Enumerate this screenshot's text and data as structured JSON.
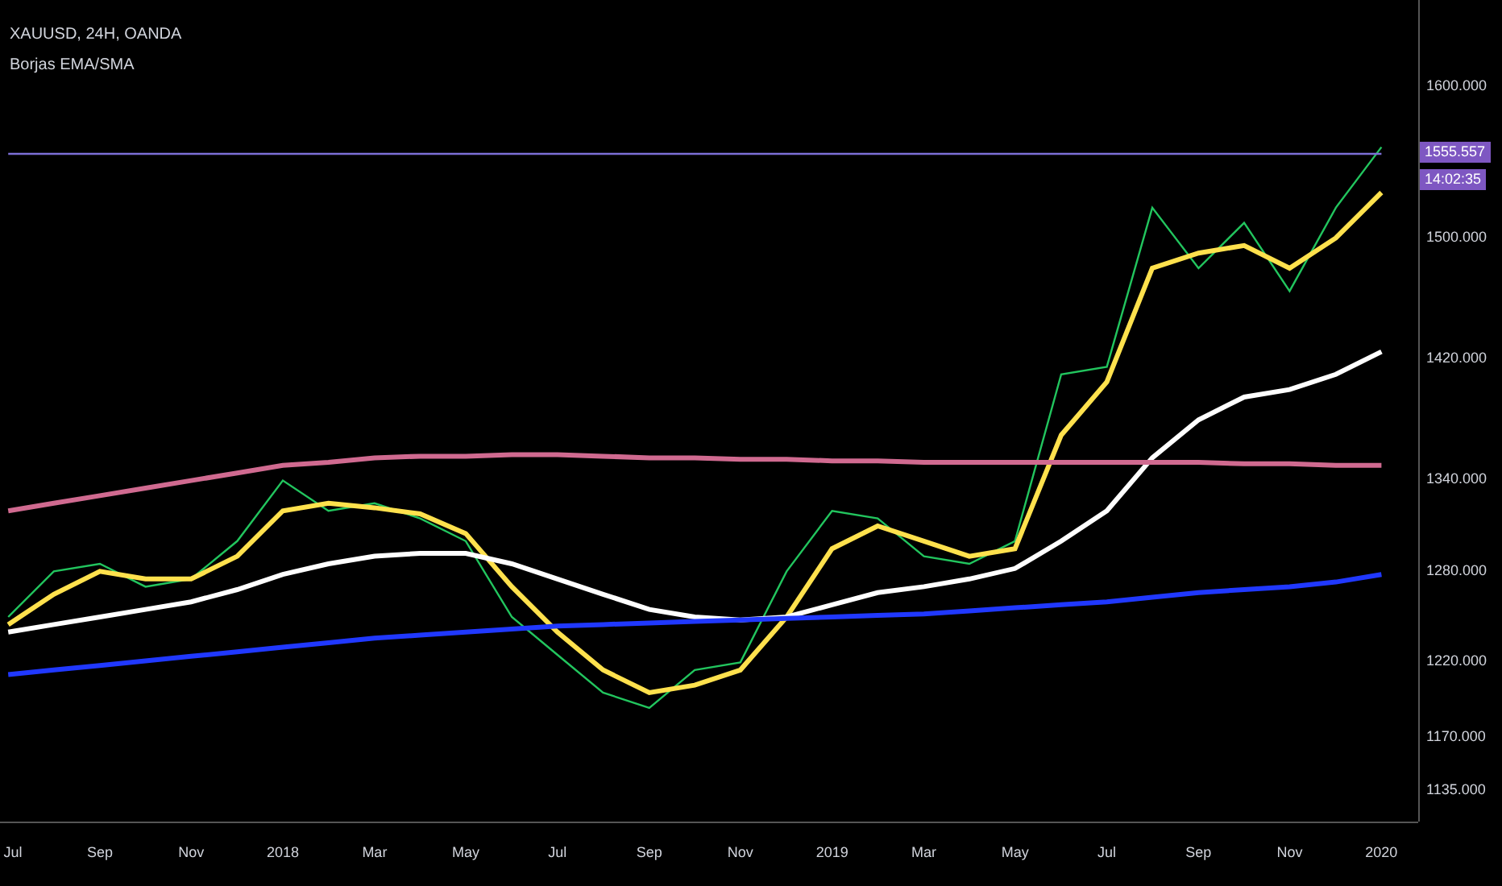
{
  "legend": {
    "symbol": "XAUUSD, 24H, OANDA",
    "indicator": "Borjas EMA/SMA"
  },
  "price_line": {
    "price": "1555.557",
    "countdown": "14:02:35"
  },
  "chart_data": {
    "type": "line",
    "x": [
      2017.5,
      2017.583,
      2017.667,
      2017.75,
      2017.833,
      2017.917,
      2018,
      2018.083,
      2018.167,
      2018.25,
      2018.333,
      2018.417,
      2018.5,
      2018.583,
      2018.667,
      2018.75,
      2018.833,
      2018.917,
      2019,
      2019.083,
      2019.167,
      2019.25,
      2019.333,
      2019.417,
      2019.5,
      2019.583,
      2019.667,
      2019.75,
      2019.833,
      2019.917,
      2020
    ],
    "xticks": [
      {
        "value": 2017.5,
        "label": "Jul"
      },
      {
        "value": 2017.667,
        "label": "Sep"
      },
      {
        "value": 2017.833,
        "label": "Nov"
      },
      {
        "value": 2018,
        "label": "2018"
      },
      {
        "value": 2018.167,
        "label": "Mar"
      },
      {
        "value": 2018.333,
        "label": "May"
      },
      {
        "value": 2018.5,
        "label": "Jul"
      },
      {
        "value": 2018.667,
        "label": "Sep"
      },
      {
        "value": 2018.833,
        "label": "Nov"
      },
      {
        "value": 2019,
        "label": "2019"
      },
      {
        "value": 2019.167,
        "label": "Mar"
      },
      {
        "value": 2019.333,
        "label": "May"
      },
      {
        "value": 2019.5,
        "label": "Jul"
      },
      {
        "value": 2019.667,
        "label": "Sep"
      },
      {
        "value": 2019.833,
        "label": "Nov"
      },
      {
        "value": 2020,
        "label": "2020"
      }
    ],
    "yticks": [
      {
        "value": 1600,
        "label": "1600.000"
      },
      {
        "value": 1500,
        "label": "1500.000"
      },
      {
        "value": 1420,
        "label": "1420.000"
      },
      {
        "value": 1340,
        "label": "1340.000"
      },
      {
        "value": 1280,
        "label": "1280.000"
      },
      {
        "value": 1220,
        "label": "1220.000"
      },
      {
        "value": 1170,
        "label": "1170.000"
      },
      {
        "value": 1135,
        "label": "1135.000"
      }
    ],
    "xlim": [
      2017.485,
      2020.067
    ],
    "ylim": [
      1115,
      1657
    ],
    "series": [
      {
        "color": "#22c55e",
        "values": [
          1250,
          1280,
          1285,
          1270,
          1275,
          1300,
          1340,
          1320,
          1325,
          1315,
          1300,
          1250,
          1225,
          1200,
          1190,
          1215,
          1220,
          1280,
          1320,
          1315,
          1290,
          1285,
          1300,
          1410,
          1415,
          1520,
          1480,
          1510,
          1465,
          1520,
          1560
        ]
      },
      {
        "color": "#ffe14d",
        "values": [
          1245,
          1265,
          1280,
          1275,
          1275,
          1290,
          1320,
          1325,
          1322,
          1318,
          1305,
          1270,
          1240,
          1215,
          1200,
          1205,
          1215,
          1250,
          1295,
          1310,
          1300,
          1290,
          1295,
          1370,
          1405,
          1480,
          1490,
          1495,
          1480,
          1500,
          1530
        ]
      },
      {
        "color": "#ffffff",
        "values": [
          1240,
          1245,
          1250,
          1255,
          1260,
          1268,
          1278,
          1285,
          1290,
          1292,
          1292,
          1285,
          1275,
          1265,
          1255,
          1250,
          1248,
          1250,
          1258,
          1266,
          1270,
          1275,
          1282,
          1300,
          1320,
          1355,
          1380,
          1395,
          1400,
          1410,
          1425
        ]
      },
      {
        "color": "#d06a90",
        "values": [
          1320,
          1325,
          1330,
          1335,
          1340,
          1345,
          1350,
          1352,
          1355,
          1356,
          1356,
          1357,
          1357,
          1356,
          1355,
          1355,
          1354,
          1354,
          1353,
          1353,
          1352,
          1352,
          1352,
          1352,
          1352,
          1352,
          1352,
          1351,
          1351,
          1350,
          1350
        ]
      },
      {
        "color": "#2038ff",
        "values": [
          1212,
          1215,
          1218,
          1221,
          1224,
          1227,
          1230,
          1233,
          1236,
          1238,
          1240,
          1242,
          1244,
          1245,
          1246,
          1247,
          1248,
          1249,
          1250,
          1251,
          1252,
          1254,
          1256,
          1258,
          1260,
          1263,
          1266,
          1268,
          1270,
          1273,
          1278
        ]
      },
      {
        "color": "#7c6fd6",
        "values": [
          1555.557,
          1555.557,
          1555.557,
          1555.557,
          1555.557,
          1555.557,
          1555.557,
          1555.557,
          1555.557,
          1555.557,
          1555.557,
          1555.557,
          1555.557,
          1555.557,
          1555.557,
          1555.557,
          1555.557,
          1555.557,
          1555.557,
          1555.557,
          1555.557,
          1555.557,
          1555.557,
          1555.557,
          1555.557,
          1555.557,
          1555.557,
          1555.557,
          1555.557,
          1555.557,
          1555.557
        ]
      }
    ]
  }
}
